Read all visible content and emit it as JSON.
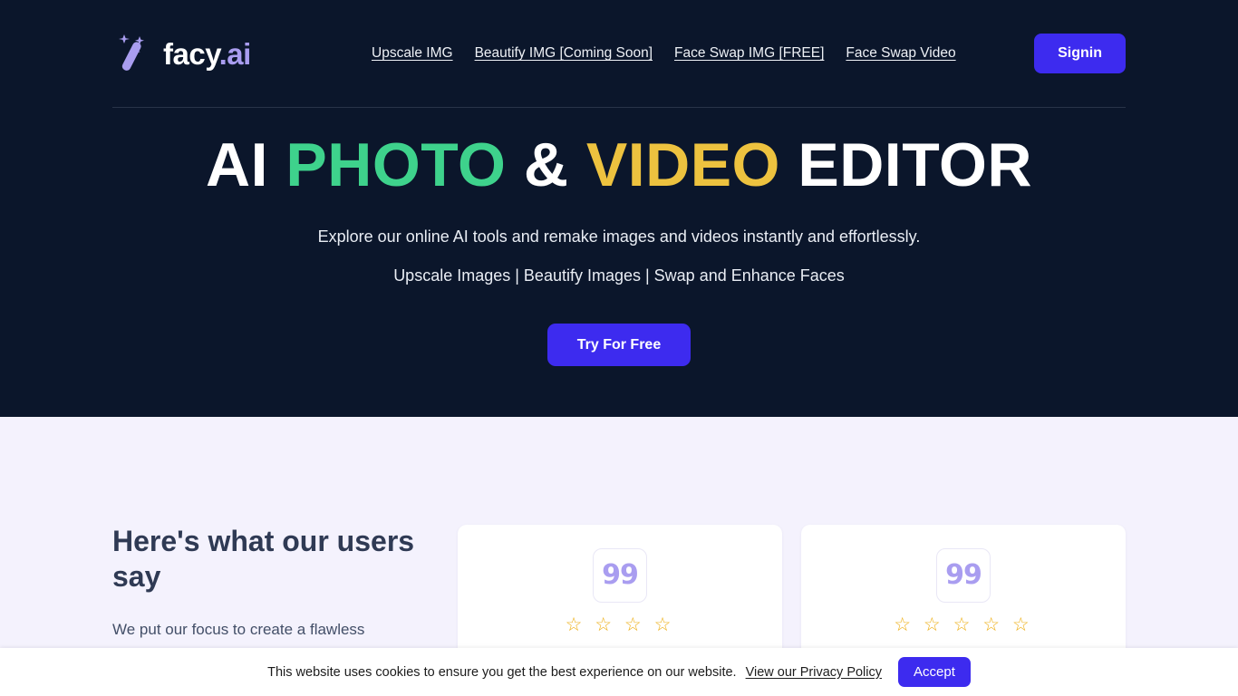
{
  "header": {
    "brand_name": "facy",
    "brand_suffix": ".ai",
    "logo_icon": "magic-wand-icon",
    "nav_links": [
      {
        "label": "Upscale IMG"
      },
      {
        "label": "Beautify IMG [Coming Soon]"
      },
      {
        "label": "Face Swap IMG [FREE]"
      },
      {
        "label": "Face Swap Video"
      }
    ],
    "signin_label": "Signin"
  },
  "hero": {
    "headline": {
      "part1": "AI ",
      "photo": "PHOTO",
      "amp": " & ",
      "video": "VIDEO",
      "part2": " EDITOR"
    },
    "subtitle": "Explore our online AI tools and remake images and videos instantly and effortlessly.",
    "features": "Upscale Images | Beautify Images | Swap and Enhance Faces",
    "cta_label": "Try For Free"
  },
  "testimonials": {
    "heading": "Here's what our users say",
    "description": "We put our focus to create a flawless",
    "cards": [
      {
        "quote_icon": "quote-icon",
        "quote_glyph": "99",
        "rating": 4,
        "stars": "☆ ☆ ☆ ☆"
      },
      {
        "quote_icon": "quote-icon",
        "quote_glyph": "99",
        "rating": 5,
        "stars": "☆ ☆ ☆ ☆ ☆"
      }
    ]
  },
  "cookie_banner": {
    "message": "This website uses cookies to ensure you get the best experience on our website.",
    "policy_link": "View our Privacy Policy",
    "accept_label": "Accept"
  },
  "colors": {
    "hero_background": "#0b162b",
    "section_background": "#f4f2fd",
    "accent_purple": "#3d2bef",
    "brand_light_purple": "#a99df0",
    "headline_green": "#3ed28c",
    "headline_yellow": "#edc23f",
    "star_gold": "#eeb018"
  }
}
